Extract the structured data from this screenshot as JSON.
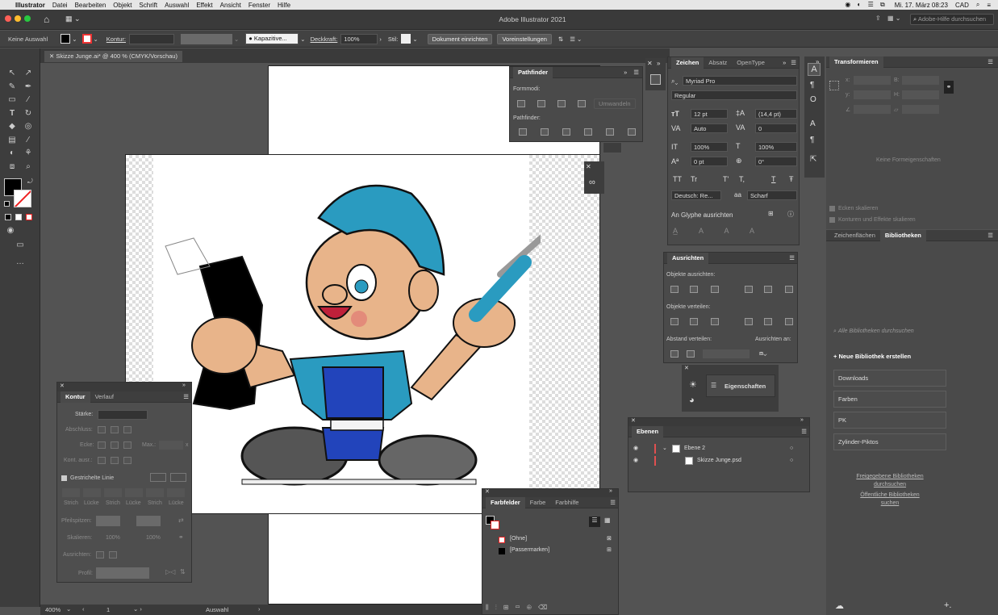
{
  "menubar": {
    "apple": "",
    "app": "Illustrator",
    "items": [
      "Datei",
      "Bearbeiten",
      "Objekt",
      "Schrift",
      "Auswahl",
      "Effekt",
      "Ansicht",
      "Fenster",
      "Hilfe"
    ],
    "datetime": "Mi. 17. März 08:23",
    "currency": "CAD"
  },
  "window": {
    "title": "Adobe Illustrator 2021",
    "search_placeholder": "Adobe-Hilfe durchsuchen"
  },
  "control": {
    "selection": "Keine Auswahl",
    "kontur": "Kontur:",
    "brush": "Kapazitive...",
    "deckkraft": "Deckkraft:",
    "deckkraft_value": "100%",
    "stil": "Stil:",
    "doc_setup": "Dokument einrichten",
    "prefs": "Voreinstellungen"
  },
  "document": {
    "tab": "Skizze Junge.ai* @ 400 % (CMYK/Vorschau)",
    "zoom": "400%",
    "artboard": "1",
    "status": "Auswahl"
  },
  "pathfinder": {
    "title": "Pathfinder",
    "formmodi": "Formmodi:",
    "umwandeln": "Umwandeln",
    "pathfinder_label": "Pathfinder:"
  },
  "zeichen": {
    "tabs": [
      "Zeichen",
      "Absatz",
      "OpenType"
    ],
    "font": "Myriad Pro",
    "style": "Regular",
    "size": "12 pt",
    "leading": "(14,4 pt)",
    "kerning": "Auto",
    "tracking": "0",
    "vscale": "100%",
    "hscale": "100%",
    "baseline": "0 pt",
    "rotation": "0°",
    "language": "Deutsch: Re...",
    "aa_label": "aa",
    "aa": "Scharf",
    "glyph": "An Glyphe ausrichten",
    "tt": [
      "TT",
      "Tr",
      "T'",
      "T,",
      "T",
      "Ŧ"
    ]
  },
  "ausrichten": {
    "title": "Ausrichten",
    "objekte_ausrichten": "Objekte ausrichten:",
    "objekte_verteilen": "Objekte verteilen:",
    "abstand_verteilen": "Abstand verteilen:",
    "ausrichten_an": "Ausrichten an:"
  },
  "eigenschaften": {
    "label": "Eigenschaften"
  },
  "transformieren": {
    "title": "Transformieren",
    "x": "x:",
    "y": "y:",
    "b": "B:",
    "h": "H:",
    "none": "Keine Formeigenschaften",
    "ecken": "Ecken skalieren",
    "konturen": "Konturen und Effekte skalieren"
  },
  "bibliotheken": {
    "tabs": [
      "Zeichenflächen",
      "Bibliotheken"
    ],
    "search": "Alle Bibliotheken durchsuchen",
    "new": "Neue Bibliothek erstellen",
    "items": [
      "Downloads",
      "Farben",
      "PK",
      "Zylinder-Piktos"
    ],
    "shared1": "Freigegebene Bibliotheken",
    "shared2": "durchsuchen",
    "public1": "Öffentliche Bibliotheken",
    "public2": "suchen"
  },
  "kontur": {
    "tabs": [
      "Kontur",
      "Verlauf"
    ],
    "staerke": "Stärke:",
    "abschluss": "Abschluss:",
    "ecke": "Ecke:",
    "max": "Max.:",
    "x": "x",
    "kont": "Kont. ausr.:",
    "gestrichelt": "Gestrichelte Linie",
    "strich": "Strich",
    "luecke": "Lücke",
    "pfeilspitzen": "Pfeilspitzen:",
    "skalieren": "Skalieren:",
    "ausrichten": "Ausrichten:",
    "profil": "Profil:",
    "pct": "100%"
  },
  "ebenen": {
    "title": "Ebenen",
    "layer": "Ebene 2",
    "sublayer": "Skizze Junge.psd"
  },
  "farbfelder": {
    "tabs": [
      "Farbfelder",
      "Farbe",
      "Farbhilfe"
    ],
    "ohne": "[Ohne]",
    "passer": "[Passermarken]"
  },
  "colors": {
    "accent": "#e05050",
    "cap": "#2a9bc0",
    "skin": "#e8b48a",
    "overall": "#2244bb"
  }
}
